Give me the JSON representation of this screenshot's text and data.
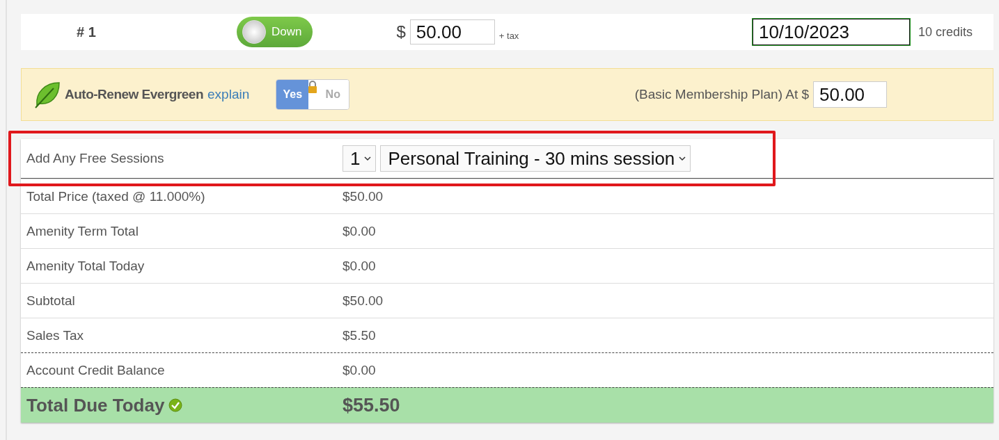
{
  "header": {
    "number": "# 1",
    "payment_toggle": {
      "label": "Down",
      "on": true
    },
    "currency": "$",
    "price": "50.00",
    "tax_note": "+ tax",
    "date": "10/10/2023",
    "credits": "10 credits"
  },
  "auto_renew": {
    "title": "Auto-Renew Evergreen",
    "link": "explain",
    "switch": {
      "options": [
        {
          "label": "Yes",
          "selected": true
        },
        {
          "label": "No",
          "selected": false
        }
      ],
      "locked": true
    },
    "plan_text": "(Basic Membership Plan) At $",
    "plan_price": "50.00"
  },
  "sessions": {
    "label": "Add Any Free Sessions",
    "quantity": "1",
    "session_type": "Personal Training - 30 mins session",
    "highlighted": true
  },
  "rows": [
    {
      "label": "Total Price (taxed @ 11.000%)",
      "value": "$50.00",
      "kind": "normal"
    },
    {
      "label": "Amenity Term Total",
      "value": "$0.00",
      "kind": "normal"
    },
    {
      "label": "Amenity Total Today",
      "value": "$0.00",
      "kind": "normal"
    },
    {
      "label": "Subtotal",
      "value": "$50.00",
      "kind": "normal"
    },
    {
      "label": "Sales Tax",
      "value": "$5.50",
      "kind": "normal"
    },
    {
      "label": "Account Credit Balance",
      "value": "$0.00",
      "kind": "dashed"
    },
    {
      "label": "Total Due Today",
      "value": "$55.50",
      "kind": "total"
    }
  ]
}
